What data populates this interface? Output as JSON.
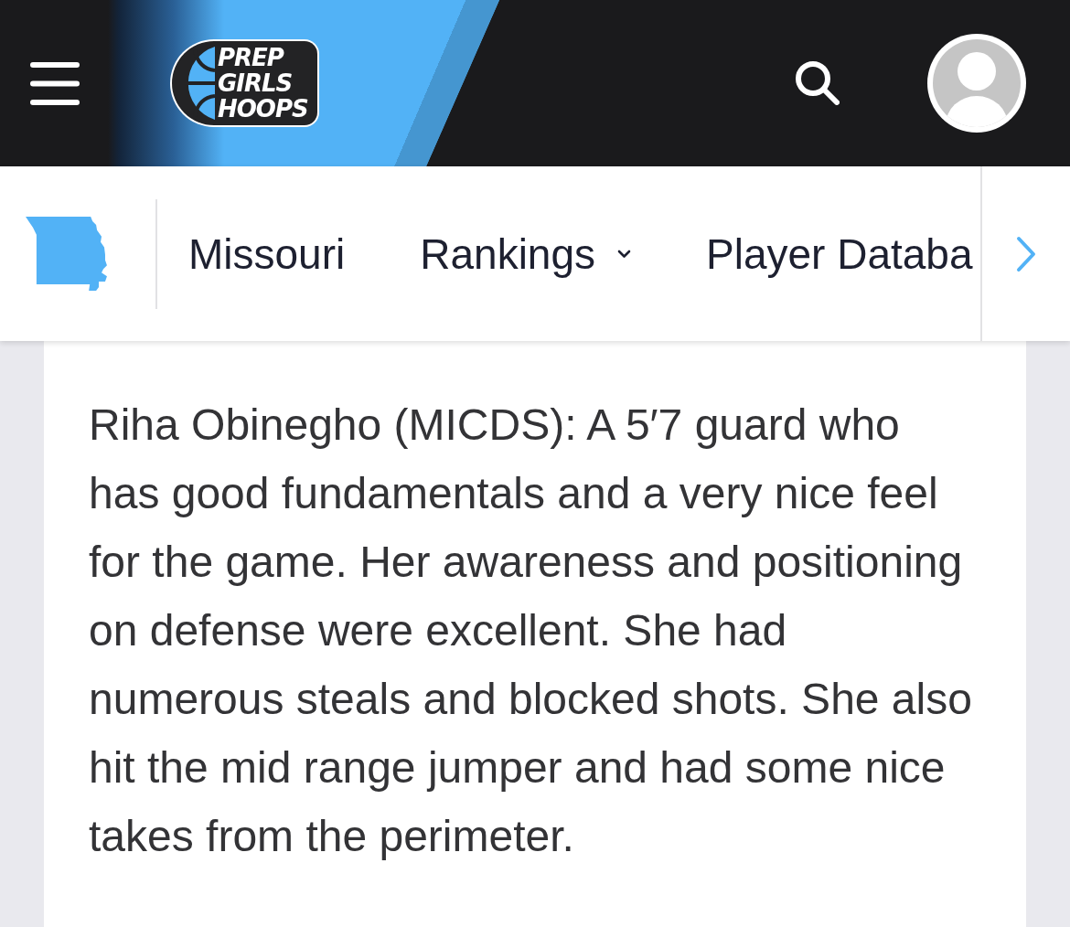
{
  "header": {
    "logo": {
      "lines": [
        "PREP",
        "GIRLS",
        "HOOPS"
      ]
    }
  },
  "nav": {
    "items": [
      {
        "label": "Missouri",
        "dropdown": false
      },
      {
        "label": "Rankings",
        "dropdown": true
      },
      {
        "label": "Player Databa",
        "dropdown": false
      }
    ]
  },
  "article": {
    "paragraph": "Riha Obinegho (MICDS): A 5′7 guard who has good fundamentals and a very nice feel for the game. Her awareness and positioning on defense were excellent. She had numerous steals and blocked shots. She also hit the mid range jumper and had some nice takes from the perimeter."
  }
}
